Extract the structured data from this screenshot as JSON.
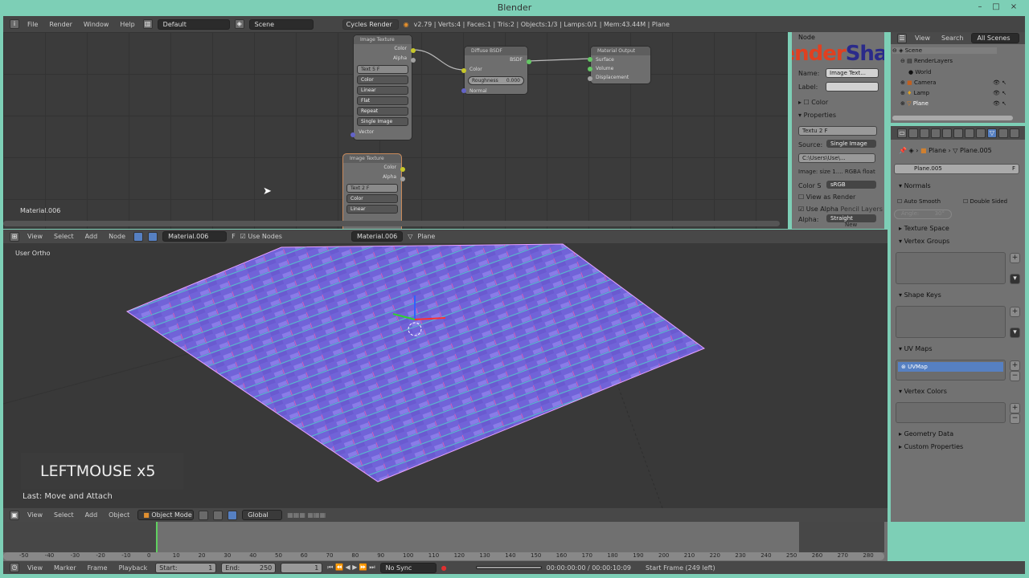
{
  "window": {
    "title": "Blender",
    "min": "–",
    "max": "□",
    "close": "×"
  },
  "info_header": {
    "menus": [
      "File",
      "Render",
      "Window",
      "Help"
    ],
    "layout": "Default",
    "scene": "Scene",
    "engine": "Cycles Render",
    "stats": "v2.79 | Verts:4 | Faces:1 | Tris:2 | Objects:1/3 | Lamps:0/1 | Mem:43.44M | Plane"
  },
  "node_editor": {
    "material_label": "Material.006",
    "nodes": [
      {
        "title": "Image Texture",
        "outputs": [
          "Color",
          "Alpha"
        ],
        "image": "Text",
        "users": "5",
        "fake": "F",
        "dropdowns": [
          "Color",
          "Linear",
          "Flat",
          "Repeat",
          "Single Image"
        ],
        "inputs": [
          "Vector"
        ]
      },
      {
        "title": "Diffuse BSDF",
        "outputs": [
          "BSDF"
        ],
        "inputs": [
          "Color",
          "Normal"
        ],
        "roughness_label": "Roughness",
        "roughness_value": "0.000"
      },
      {
        "title": "Material Output",
        "inputs": [
          "Surface",
          "Volume",
          "Displacement"
        ]
      },
      {
        "title": "Image Texture",
        "outputs": [
          "Color",
          "Alpha"
        ],
        "image": "Text",
        "users": "2",
        "fake": "F",
        "dropdowns": [
          "Color",
          "Linear"
        ]
      }
    ],
    "header": {
      "menus": [
        "View",
        "Select",
        "Add",
        "Node"
      ],
      "material": "Material.006",
      "fake": "F",
      "use_nodes": "Use Nodes",
      "slot_material": "Material.006",
      "object": "Plane"
    }
  },
  "node_sidebar": {
    "panel": "Node",
    "name_label": "Name:",
    "name_value": "Image Text...",
    "label_label": "Label:",
    "color": "Color",
    "properties": "Properties",
    "image": "Textu",
    "users": "2",
    "fake": "F",
    "source_label": "Source:",
    "source_value": "Single Image",
    "filepath": "C:\\Users\\Use\\...",
    "image_info": "Image: size 1.... RGBA float",
    "colorspace_label": "Color S",
    "colorspace_value": "sRGB",
    "view_as_render": "View as Render",
    "use_alpha": "Use Alpha",
    "pencil_layers": "Pencil Layers",
    "alpha_label": "Alpha:",
    "alpha_value": "Straight",
    "new": "New",
    "watermark": "BlenderShare"
  },
  "outliner": {
    "menus": [
      "View",
      "Search"
    ],
    "filter": "All Scenes",
    "items": [
      "Scene",
      "RenderLayers",
      "World",
      "Camera",
      "Lamp",
      "Plane"
    ]
  },
  "properties": {
    "breadcrumb": [
      "Plane",
      "Plane.005"
    ],
    "mesh_name": "Plane.005",
    "fake": "F",
    "normals": {
      "title": "Normals",
      "auto_smooth": "Auto Smooth",
      "double_sided": "Double Sided",
      "angle_label": "Angle:",
      "angle_value": "30°"
    },
    "panels": [
      "Texture Space",
      "Vertex Groups",
      "Shape Keys",
      "UV Maps",
      "Vertex Colors",
      "Geometry Data",
      "Custom Properties"
    ],
    "uv_map": "UVMap"
  },
  "viewport": {
    "label": "User Ortho",
    "last_op": "Last: Move and Attach",
    "key_overlay": "LEFTMOUSE x5",
    "header": {
      "menus": [
        "View",
        "Select",
        "Add",
        "Object"
      ],
      "mode": "Object Mode",
      "orientation": "Global"
    }
  },
  "timeline": {
    "ticks": [
      "-50",
      "-40",
      "-30",
      "-20",
      "-10",
      "0",
      "10",
      "20",
      "30",
      "40",
      "50",
      "60",
      "70",
      "80",
      "90",
      "100",
      "110",
      "120",
      "130",
      "140",
      "150",
      "160",
      "170",
      "180",
      "190",
      "200",
      "210",
      "220",
      "230",
      "240",
      "250",
      "260",
      "270",
      "280"
    ],
    "menus": [
      "View",
      "Marker",
      "Frame",
      "Playback"
    ],
    "start_label": "Start:",
    "start": "1",
    "end_label": "End:",
    "end": "250",
    "current": "1",
    "sync": "No Sync",
    "time": "00:00:00:00 / 00:00:10:09",
    "status": "Start Frame (249 left)"
  }
}
